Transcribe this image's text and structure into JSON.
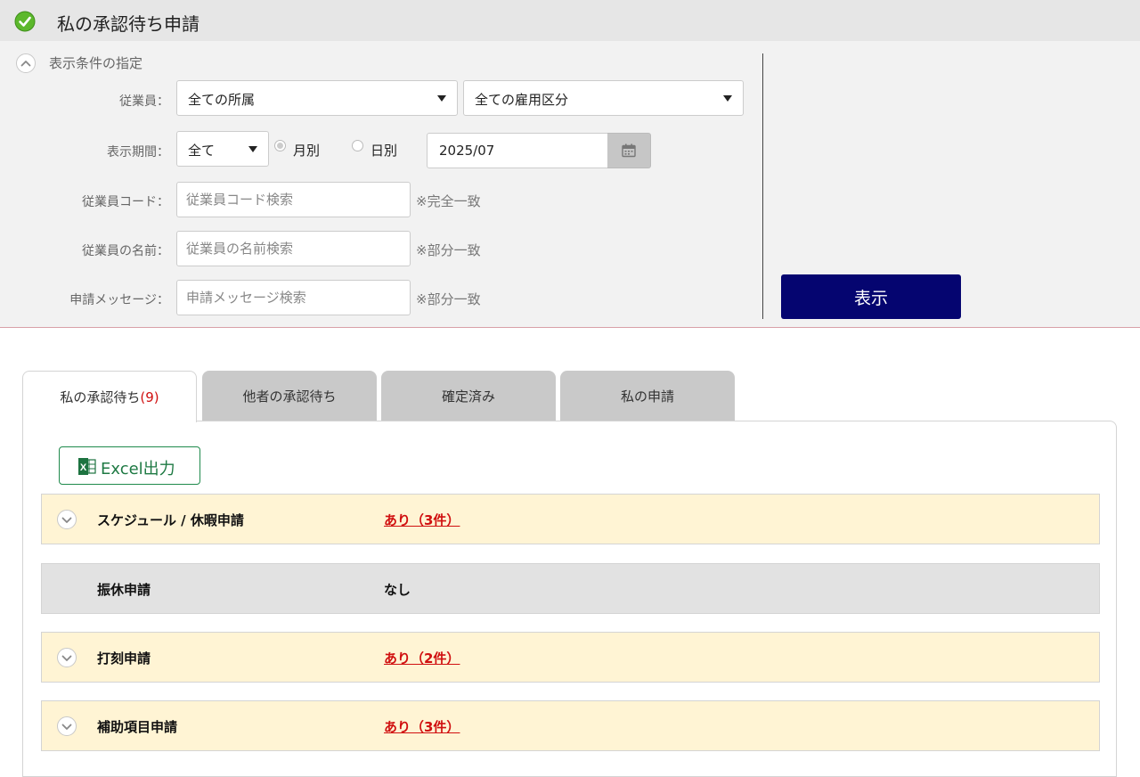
{
  "header": {
    "title": "私の承認待ち申請",
    "check_icon": "check-circle-icon",
    "accent_color": "#4caf20"
  },
  "filters": {
    "heading": "表示条件の指定",
    "employee": {
      "label": "従業員：",
      "department": "全ての所属",
      "employment_type": "全ての雇用区分"
    },
    "period": {
      "label": "表示期間：",
      "scope": "全て",
      "radio_monthly": "月別",
      "radio_daily": "日別",
      "selected_radio": "monthly",
      "date_value": "2025/07",
      "calendar_icon": "calendar-icon"
    },
    "code": {
      "label": "従業員コード：",
      "placeholder": "従業員コード検索",
      "hint": "※完全一致"
    },
    "name": {
      "label": "従業員の名前：",
      "placeholder": "従業員の名前検索",
      "hint": "※部分一致"
    },
    "message": {
      "label": "申請メッセージ：",
      "placeholder": "申請メッセージ検索",
      "hint": "※部分一致"
    },
    "show_button": "表示",
    "show_button_color": "#050570"
  },
  "tabs": [
    {
      "label": "私の承認待ち",
      "count": "(9)",
      "active": true
    },
    {
      "label": "他者の承認待ち",
      "active": false
    },
    {
      "label": "確定済み",
      "active": false
    },
    {
      "label": "私の申請",
      "active": false
    }
  ],
  "toolbar": {
    "excel_label": "Excel出力",
    "excel_icon": "excel-icon"
  },
  "requests": [
    {
      "name": "スケジュール / 休暇申請",
      "status": "あり（3件）",
      "has_items": true
    },
    {
      "name": "振休申請",
      "status": "なし",
      "has_items": false
    },
    {
      "name": "打刻申請",
      "status": "あり（2件）",
      "has_items": true
    },
    {
      "name": "補助項目申請",
      "status": "あり（3件）",
      "has_items": true
    }
  ]
}
